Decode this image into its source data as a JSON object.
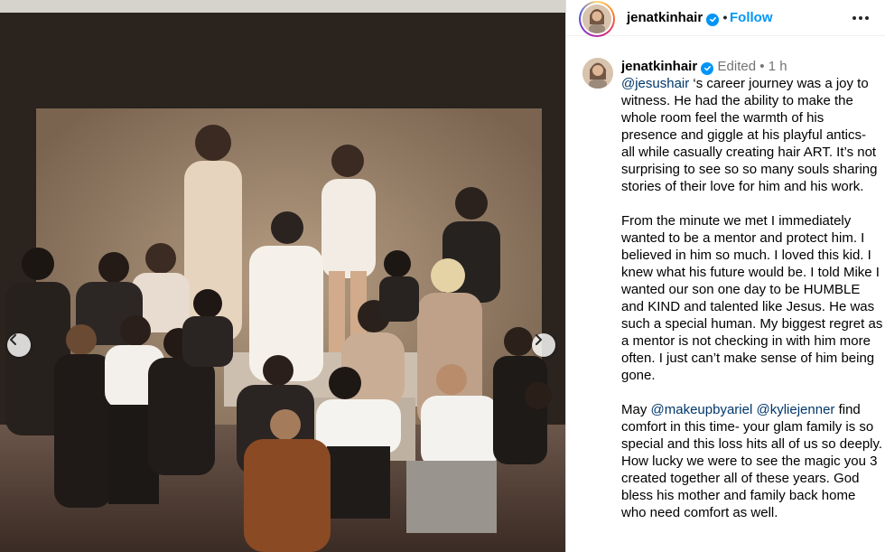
{
  "post": {
    "username": "jenatkinhair",
    "follow_label": "Follow",
    "more_label": "More options"
  },
  "comment": {
    "username": "jenatkinhair",
    "edited": "Edited",
    "separator": "•",
    "time": "1 h",
    "p1_mention": "@jesushair",
    "p1_text": " ‘s career journey was a joy to witness. He had the ability to make the whole room feel the warmth of his presence and giggle at his playful antics- all while casually creating hair ART. It’s not surprising to see so so many souls sharing stories of their love for him and his work.",
    "p2_text": "From the minute we met I immediately wanted to be a mentor and protect him. I believed in him so much. I loved this kid. I knew what his future would be. I told Mike I wanted our son one day to be HUMBLE and KIND and talented like Jesus. He was such a special human. My biggest regret as a mentor is not checking in with him more often. I just can’t make sense of him being gone.",
    "p3_prefix": "May ",
    "p3_mention1": "@makeupbyariel",
    "p3_space": " ",
    "p3_mention2": "@kyliejenner",
    "p3_text": " find comfort in this time- your glam family is so special and this loss hits all of us so deeply. How lucky we were to see the magic you 3 created together all of these years. God bless his mother and family back home who need comfort as well."
  },
  "colors": {
    "accent": "#0095f6",
    "mention": "#00376b",
    "muted": "#737373"
  },
  "icons": {
    "verified": "verified-badge-icon",
    "prev": "chevron-left-icon",
    "next": "chevron-right-icon",
    "more": "more-horizontal-icon"
  }
}
